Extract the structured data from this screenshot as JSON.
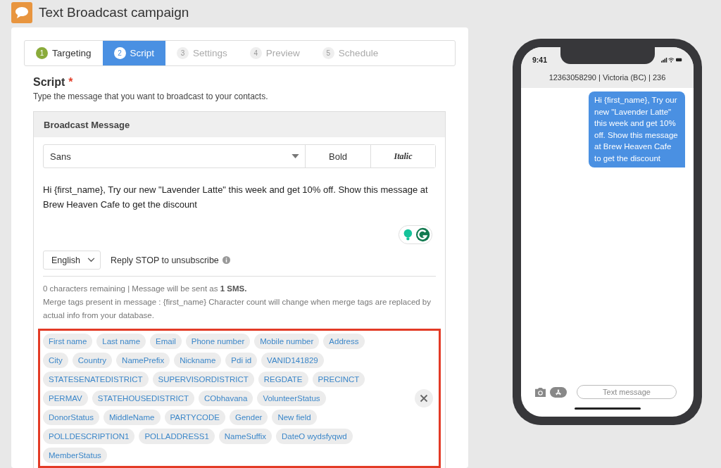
{
  "page": {
    "title": "Text Broadcast campaign"
  },
  "steps": [
    {
      "number": "1",
      "label": "Targeting",
      "selected": false,
      "completed": true
    },
    {
      "number": "2",
      "label": "Script",
      "selected": true,
      "completed": false
    },
    {
      "number": "3",
      "label": "Settings",
      "selected": false,
      "completed": false
    },
    {
      "number": "4",
      "label": "Preview",
      "selected": false,
      "completed": false
    },
    {
      "number": "5",
      "label": "Schedule",
      "selected": false,
      "completed": false
    }
  ],
  "script": {
    "heading": "Script",
    "required_mark": "*",
    "description": "Type the message that you want to broadcast to your contacts."
  },
  "broadcast_message": {
    "title": "Broadcast Message",
    "font_select": "Sans",
    "bold_button": "Bold",
    "italic_button": "Italic",
    "message": "Hi {first_name}, Try our new \"Lavender Latte\" this week and get 10% off. Show this message at Brew Heaven Cafe to get the discount",
    "language": "English",
    "opt_out": "Reply STOP to unsubscribe",
    "character_info": "0 characters remaining | Message will be sent as **1 SMS.**",
    "merge_info": "Merge tags present in message : {first_name} Character count will change when merge tags are replaced by actual info from your database.",
    "merge_tags_highlighted": true,
    "merge_tags": [
      "First name",
      "Last name",
      "Email",
      "Phone number",
      "Mobile number",
      "Address",
      "City",
      "Country",
      "NamePrefix",
      "Nickname",
      "Pdi id",
      "VANID141829",
      "STATESENATEDISTRICT",
      "SUPERVISORDISTRICT",
      "REGDATE",
      "PRECINCT",
      "PERMAV",
      "STATEHOUSEDISTRICT",
      "CObhavana",
      "VolunteerStatus",
      "DonorStatus",
      "MiddleName",
      "PARTYCODE",
      "Gender",
      "New field",
      "POLLDESCRIPTION1",
      "POLLADDRESS1",
      "NameSuffix",
      "DateO wydsfyqwd",
      "MemberStatus"
    ]
  },
  "phone_preview": {
    "time": "9:41",
    "contact": "12363058290 | Victoria (BC) | 236",
    "message": "Hi {first_name}, Try our new \"Lavender Latte\" this week and get 10% off. Show this message at Brew Heaven Cafe to get the discount",
    "input_placeholder": "Text message"
  }
}
